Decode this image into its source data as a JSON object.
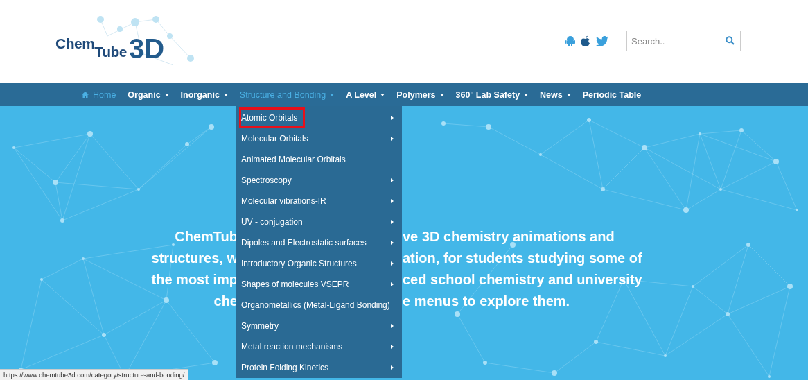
{
  "header": {
    "logo": {
      "parts": [
        "Chem",
        "Tube",
        "3D"
      ]
    },
    "search": {
      "placeholder": "Search.."
    }
  },
  "nav": {
    "items": [
      {
        "label": "Home",
        "kind": "home",
        "active": true,
        "dropdown": false
      },
      {
        "label": "Organic",
        "kind": "link",
        "active": false,
        "dropdown": true
      },
      {
        "label": "Inorganic",
        "kind": "link",
        "active": false,
        "dropdown": true
      },
      {
        "label": "Structure and Bonding",
        "kind": "link",
        "active": true,
        "dropdown": true
      },
      {
        "label": "A Level",
        "kind": "link",
        "active": false,
        "dropdown": true
      },
      {
        "label": "Polymers",
        "kind": "link",
        "active": false,
        "dropdown": true
      },
      {
        "label": "360° Lab Safety",
        "kind": "link",
        "active": false,
        "dropdown": true
      },
      {
        "label": "News",
        "kind": "link",
        "active": false,
        "dropdown": true
      },
      {
        "label": "Periodic Table",
        "kind": "link",
        "active": false,
        "dropdown": false
      }
    ]
  },
  "menu": {
    "items": [
      {
        "label": "Atomic Orbitals",
        "submenu": true,
        "highlighted": true
      },
      {
        "label": "Molecular Orbitals",
        "submenu": true,
        "highlighted": false
      },
      {
        "label": "Animated Molecular Orbitals",
        "submenu": false,
        "highlighted": false
      },
      {
        "label": "Spectroscopy",
        "submenu": true,
        "highlighted": false
      },
      {
        "label": "Molecular vibrations-IR",
        "submenu": true,
        "highlighted": false
      },
      {
        "label": "UV - conjugation",
        "submenu": true,
        "highlighted": false
      },
      {
        "label": "Dipoles and Electrostatic surfaces",
        "submenu": true,
        "highlighted": false
      },
      {
        "label": "Introductory Organic Structures",
        "submenu": true,
        "highlighted": false
      },
      {
        "label": "Shapes of molecules VSEPR",
        "submenu": true,
        "highlighted": false
      },
      {
        "label": "Organometallics (Metal-Ligand Bonding)",
        "submenu": false,
        "highlighted": false
      },
      {
        "label": "Symmetry",
        "submenu": true,
        "highlighted": false
      },
      {
        "label": "Metal reaction mechanisms",
        "submenu": true,
        "highlighted": false
      },
      {
        "label": "Protein Folding Kinetics",
        "submenu": true,
        "highlighted": false
      }
    ]
  },
  "hero": {
    "lines": [
      {
        "left": "ChemTub",
        "right": "ve 3D chemistry animations and"
      },
      {
        "left": "structures, w",
        "right": "ation, for students studying some of"
      },
      {
        "left": "the most imp",
        "right": "ced school chemistry and university"
      },
      {
        "left": "che",
        "right": "e menus to explore them."
      }
    ]
  },
  "status_bar": {
    "url": "https://www.chemtube3d.com/category/structure-and-bonding/"
  }
}
